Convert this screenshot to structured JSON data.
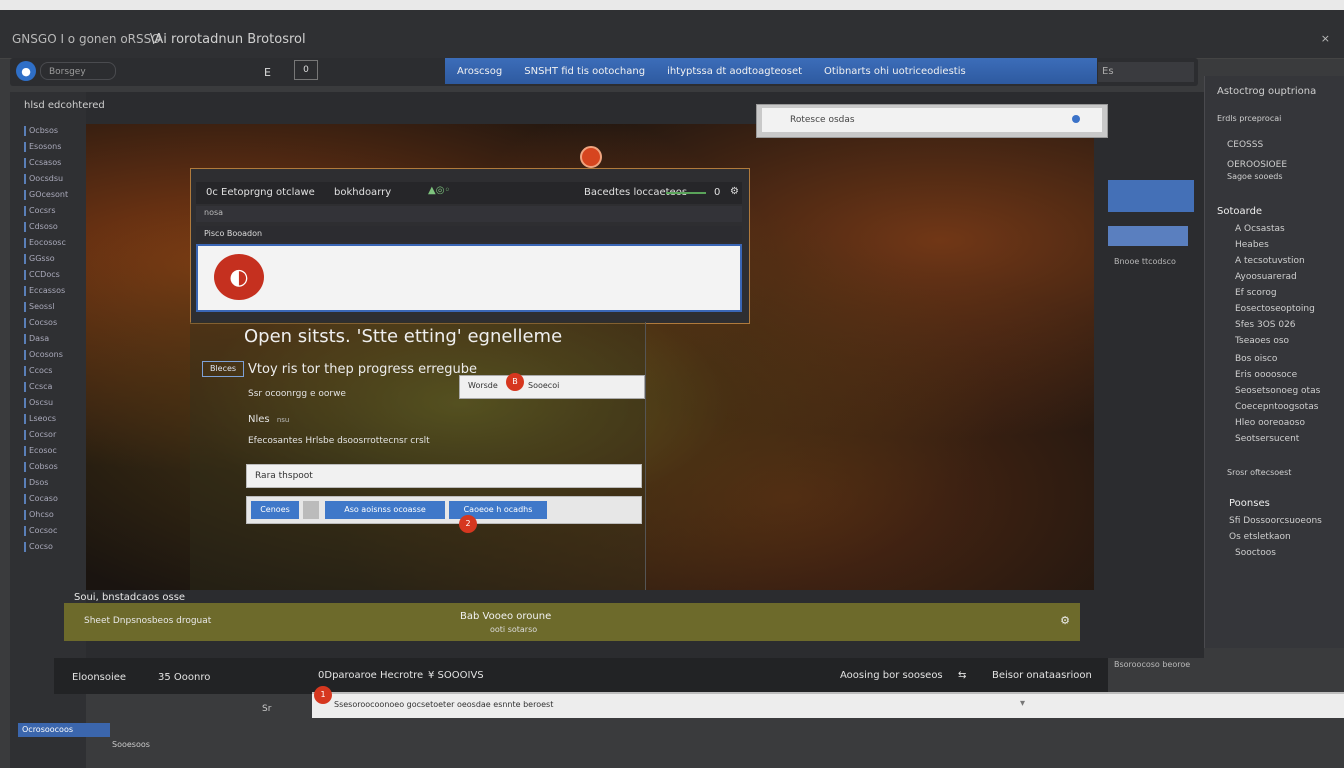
{
  "window": {
    "app_label": "GNSGO I o gonen oRSSO",
    "title": "\\Ai rorotadnun Brotosrol",
    "close_label": "×"
  },
  "toolbar": {
    "search_placeholder": "Borsgey",
    "mini_label": "E",
    "square_label": "0",
    "tabs": [
      "Aroscsog",
      "SNSHT fid tis ootochang",
      "ihtyptssa dt aodtoagteoset",
      "Otibnarts ohi uotriceodiestis"
    ],
    "right_field": "Es"
  },
  "left_panel": {
    "heading": "hlsd edcohtered",
    "items": [
      "Ocbsos",
      "Esosons",
      "Ccsasos",
      "Oocsdsu",
      "GOcesont",
      "Cocsrs",
      "Cdsoso",
      "Eocososc",
      "GGsso",
      "CCDocs",
      "Eccassos",
      "Seossl",
      "Cocsos",
      "Dasa",
      "Ocosons",
      "Ccocs",
      "Ccsca",
      "Oscsu",
      "Lseocs",
      "Cocsor",
      "Ecosoc",
      "Cobsos",
      "Dsos",
      "Cocaso",
      "Ohcso",
      "Cocsoc",
      "Cocso"
    ]
  },
  "dialog": {
    "toolbar_text": "0c Eetoprgng otclawe",
    "toolbar_text2": "bokhdoarry",
    "toolbar_right": "Bacedtes loccaeteos",
    "toolbar_count": "0",
    "sub_row": "nosa",
    "sub_row2": "Pisco Booadon"
  },
  "content": {
    "title": "Open sitsts. 'Stte etting' egnelleme",
    "tag": "Bleces",
    "subtitle": "Vtoy ris tor thep progress erregube",
    "popup_left": "Worsde",
    "popup_right": "Sooecoi",
    "popup_badge": "B",
    "line1": "Ssr ocoonrgg e oorwe",
    "line2": "Nles",
    "line2_small": "nsu",
    "line3": "Efecosantes Hrlsbe dsoosrrottecnsr crslt",
    "input_value": "Rara thspoot",
    "btn1": "Cenoes",
    "btn2": "Aso aoisnss ocoasse",
    "btn3": "Caoeoe h ocadhs",
    "btn_badge": "2"
  },
  "right_popup": {
    "text": "Rotesce osdas"
  },
  "right_side": {
    "note": "Bnooe ttcodsco"
  },
  "right_panel": {
    "header": "Astoctrog ouptriona",
    "subheader": "Erdls prceprocai",
    "group1": [
      "CEOSSS",
      "OEROOSIOEE",
      "Sagoe sooeds"
    ],
    "section1": "Sotoarde",
    "items1": [
      "A Ocsastas",
      "Heabes",
      "A tecsotuvstion",
      "Ayoosuarerad",
      "Ef scorog",
      "Eosectoseoptoing",
      "Sfes 3OS 026",
      "Tseaoes oso",
      "Bos oisco",
      "Eris oooosoce",
      "Seosetsonoeg otas",
      "Coecepntoogsotas",
      "Hleo ooreoaoso",
      "Seotsersucent"
    ],
    "section2_note": "Srosr oftecsoest",
    "section2": "Poonses",
    "items2": [
      "Sfi Dossoorcsuoeons",
      "Os etsletkaon",
      "Sooctoos"
    ]
  },
  "status": {
    "top_label": "Soui, bnstadcaos osse",
    "left": "Sheet Dnpsnosbeos droguat",
    "center": "Bab Vooeo oroune",
    "center_sub": "ooti sotarso",
    "right": "⚙"
  },
  "bottom": {
    "left_label": "Eloonsoiee",
    "count": "35   Ooonro",
    "middle": "0Dparoaroe Hecrotre",
    "middle2": "¥ SOOOIVS",
    "right1": "Aoosing bor sooseos",
    "right2": "Beisor onataasrioon",
    "side_note": "Bsoroocoso beoroe",
    "input_text": "Ssesoroocoonoeo gocsetoeter oeosdae esnnte beroest",
    "input_badge": "1",
    "small_field": "Sr"
  },
  "bottom_left": {
    "blue_label": "Ocrosoocoos",
    "text": "Sooesoos"
  }
}
